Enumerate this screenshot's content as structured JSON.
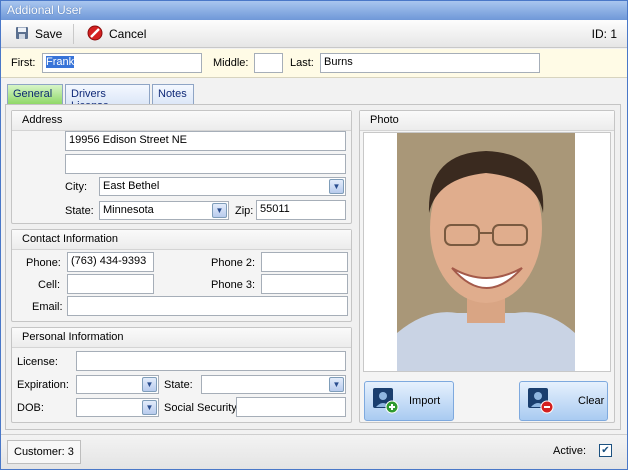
{
  "window": {
    "title": "Addional User"
  },
  "toolbar": {
    "save_label": "Save",
    "cancel_label": "Cancel",
    "id_text": "ID: 1"
  },
  "name": {
    "first_label": "First:",
    "first_value": "Frank",
    "middle_label": "Middle:",
    "middle_value": "",
    "last_label": "Last:",
    "last_value": "Burns"
  },
  "tabs": [
    {
      "label": "General",
      "active": true
    },
    {
      "label": "Drivers License",
      "active": false
    },
    {
      "label": "Notes",
      "active": false
    }
  ],
  "address": {
    "title": "Address",
    "line1": "19956 Edison Street NE",
    "line2": "",
    "city_label": "City:",
    "city_value": "East Bethel",
    "state_label": "State:",
    "state_value": "Minnesota",
    "zip_label": "Zip:",
    "zip_value": "55011"
  },
  "contact": {
    "title": "Contact Information",
    "phone_label": "Phone:",
    "phone_value": "(763) 434-9393",
    "phone2_label": "Phone 2:",
    "phone2_value": "",
    "cell_label": "Cell:",
    "cell_value": "",
    "phone3_label": "Phone 3:",
    "phone3_value": "",
    "email_label": "Email:",
    "email_value": ""
  },
  "personal": {
    "title": "Personal Information",
    "license_label": "License:",
    "license_value": "",
    "expiration_label": "Expiration:",
    "expiration_value": "",
    "state_label": "State:",
    "state_value": "",
    "dob_label": "DOB:",
    "dob_value": "",
    "ssn_label": "Social Security:",
    "ssn_value": ""
  },
  "photo": {
    "title": "Photo",
    "import_label": "Import",
    "clear_label": "Clear"
  },
  "status": {
    "customer_text": "Customer: 3",
    "active_label": "Active:",
    "active_checked": true
  }
}
